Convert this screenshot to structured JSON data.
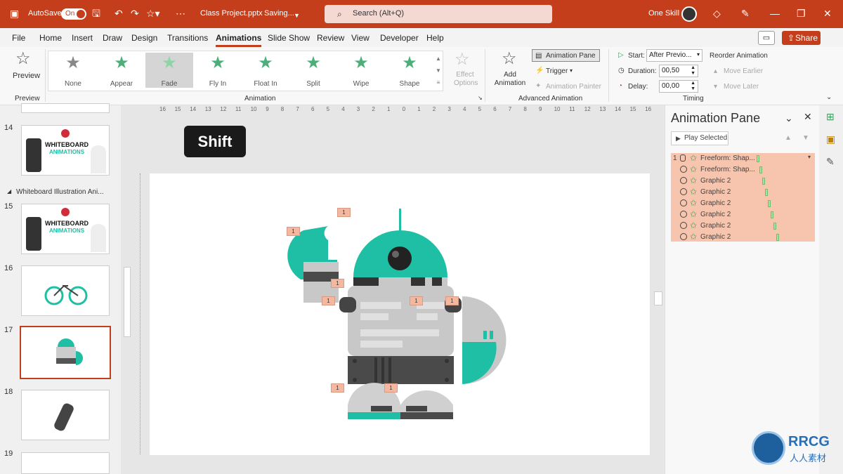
{
  "titlebar": {
    "autosave": "AutoSave",
    "toggle": "On",
    "filename": "Class Project.pptx",
    "status": "Saving...",
    "search_placeholder": "Search (Alt+Q)",
    "user": "One Skill"
  },
  "menu": [
    "File",
    "Home",
    "Insert",
    "Draw",
    "Design",
    "Transitions",
    "Animations",
    "Slide Show",
    "Review",
    "View",
    "Developer",
    "Help"
  ],
  "active_menu": "Animations",
  "share": "Share",
  "ribbon": {
    "preview_label": "Preview",
    "preview_group": "Preview",
    "effects": [
      "None",
      "Appear",
      "Fade",
      "Fly In",
      "Float In",
      "Split",
      "Wipe",
      "Shape"
    ],
    "effect_options": "Effect Options",
    "animation_group": "Animation",
    "add_animation": "Add Animation",
    "animation_pane": "Animation Pane",
    "trigger": "Trigger",
    "animation_painter": "Animation Painter",
    "advanced_group": "Advanced Animation",
    "start_label": "Start:",
    "start_value": "After Previo...",
    "duration_label": "Duration:",
    "duration_value": "00,50",
    "delay_label": "Delay:",
    "delay_value": "00,00",
    "timing_group": "Timing",
    "reorder": "Reorder Animation",
    "move_earlier": "Move Earlier",
    "move_later": "Move Later"
  },
  "slides": {
    "section_title": "Whiteboard Illustration Ani...",
    "numbers": [
      "14",
      "15",
      "16",
      "17",
      "18",
      "19"
    ],
    "thumb_title": "WHITEBOARD",
    "thumb_sub": "ANIMATIONS"
  },
  "shift_key": "Shift",
  "anim_pane": {
    "title": "Animation Pane",
    "play": "Play Selected",
    "items": [
      {
        "num": "1",
        "name": "Freeform: Shap..."
      },
      {
        "num": "",
        "name": "Freeform: Shap..."
      },
      {
        "num": "",
        "name": "Graphic 2"
      },
      {
        "num": "",
        "name": "Graphic 2"
      },
      {
        "num": "",
        "name": "Graphic 2"
      },
      {
        "num": "",
        "name": "Graphic 2"
      },
      {
        "num": "",
        "name": "Graphic 2"
      },
      {
        "num": "",
        "name": "Graphic 2"
      }
    ]
  },
  "tag_label": "1",
  "ruler_top": [
    "16",
    "15",
    "14",
    "13",
    "12",
    "11",
    "10",
    "9",
    "8",
    "7",
    "6",
    "5",
    "4",
    "3",
    "2",
    "1",
    "0",
    "1",
    "2",
    "3",
    "4",
    "5",
    "6",
    "7",
    "8",
    "9",
    "10",
    "11",
    "12",
    "13",
    "14",
    "15",
    "16"
  ],
  "watermark": {
    "brand": "RRCG",
    "sub": "人人素材"
  },
  "colors": {
    "accent": "#c43e1c",
    "robot_teal": "#1fbfa5",
    "robot_grey": "#c8c8c8",
    "robot_dark": "#4a4a4a",
    "tag": "#f4b8a0"
  }
}
